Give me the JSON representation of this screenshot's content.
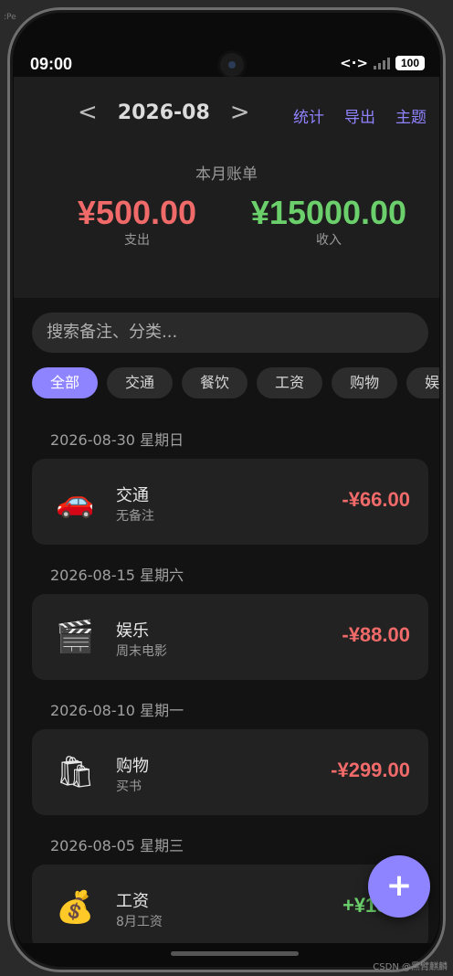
{
  "status_bar": {
    "time": "09:00",
    "network": "<·>",
    "battery": "100"
  },
  "header": {
    "prev": "<",
    "next": ">",
    "month": "2026-08",
    "actions": [
      "统计",
      "导出",
      "主题"
    ],
    "bill_label": "本月账单",
    "expense": {
      "value": "¥500.00",
      "label": "支出"
    },
    "income": {
      "value": "¥15000.00",
      "label": "收入"
    }
  },
  "search": {
    "placeholder": "搜索备注、分类..."
  },
  "filters": [
    "全部",
    "交通",
    "餐饮",
    "工资",
    "购物",
    "娱"
  ],
  "transactions": [
    {
      "date": "2026-08-30 星期日",
      "icon": "car-icon",
      "emoji": "🚗",
      "category": "交通",
      "note": "无备注",
      "amount": "-¥66.00"
    },
    {
      "date": "2026-08-15 星期六",
      "icon": "clapperboard-icon",
      "emoji": "🎬",
      "category": "娱乐",
      "note": "周末电影",
      "amount": "-¥88.00"
    },
    {
      "date": "2026-08-10 星期一",
      "icon": "shopping-bags-icon",
      "emoji": "🛍",
      "category": "购物",
      "note": "买书",
      "amount": "-¥299.00"
    },
    {
      "date": "2026-08-05 星期三",
      "icon": "money-bag-icon",
      "emoji": "💰",
      "category": "工资",
      "note": "8月工资",
      "amount": "+¥1500"
    }
  ],
  "fab": "+",
  "watermark": "CSDN @黑臂麒麟",
  "colors": {
    "accent": "#8e84ff",
    "expense": "#f06a6a",
    "income": "#6bd06b"
  }
}
